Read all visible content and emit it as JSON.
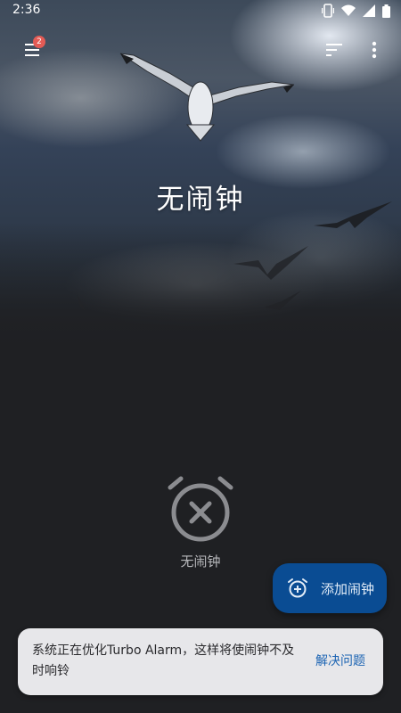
{
  "status_bar": {
    "time": "2:36",
    "icons": [
      "vibrate-icon",
      "wifi-icon",
      "signal-icon",
      "battery-icon"
    ]
  },
  "top_bar": {
    "menu_icon": "menu-icon",
    "notification_count": "2",
    "sort_icon": "sort-icon",
    "more_icon": "more-vertical-icon"
  },
  "hero": {
    "title": "无闹钟"
  },
  "empty_state": {
    "icon": "alarm-off-icon",
    "label": "无闹钟"
  },
  "fab": {
    "icon": "add-alarm-icon",
    "label": "添加闹钟",
    "color": "#0a4c93"
  },
  "snackbar": {
    "message": "系统正在优化Turbo Alarm，这样将使闹钟不及时响铃",
    "action": "解决问题"
  },
  "colors": {
    "background": "#1f2023",
    "accent": "#1c64b3",
    "badge": "#e45b55"
  }
}
